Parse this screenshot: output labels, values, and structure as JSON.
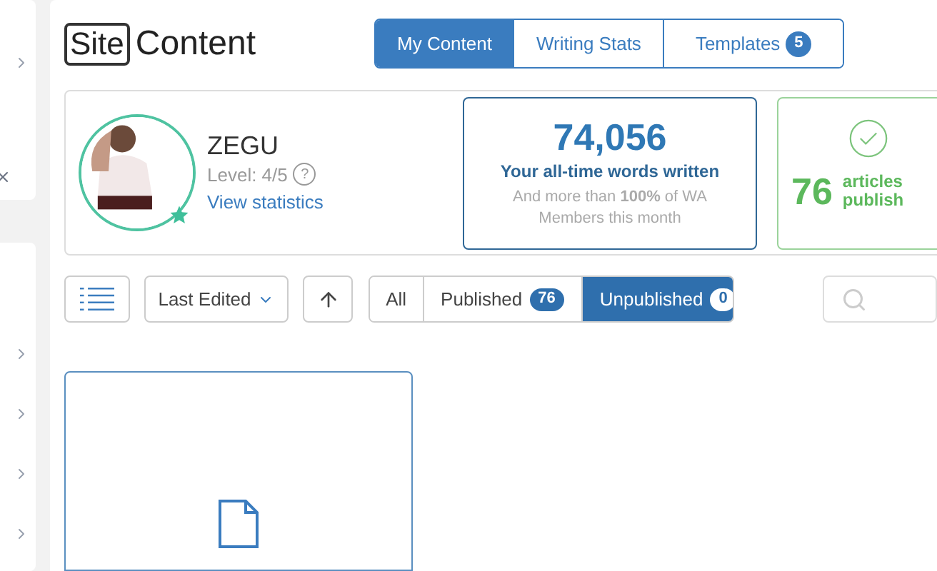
{
  "header": {
    "logo_box": "Site",
    "title": "Content"
  },
  "tabs": [
    {
      "label": "My Content",
      "selected": true
    },
    {
      "label": "Writing Stats",
      "selected": false
    },
    {
      "label": "Templates",
      "selected": false,
      "count": "5"
    }
  ],
  "profile": {
    "name": "ZEGU",
    "level": "Level: 4/5",
    "help": "?",
    "link": "View statistics"
  },
  "words": {
    "value": "74,056",
    "caption": "Your all-time words written",
    "note": "And more than **100%** of WA Members this month"
  },
  "published": {
    "value": "76",
    "line1": "articles",
    "line2": "publish"
  },
  "toolbar": {
    "sort": "Last Edited"
  },
  "filters": [
    {
      "label": "All",
      "selected": false
    },
    {
      "label": "Published",
      "selected": false,
      "count": "76"
    },
    {
      "label": "Unpublished",
      "selected": true,
      "count": "0"
    }
  ]
}
